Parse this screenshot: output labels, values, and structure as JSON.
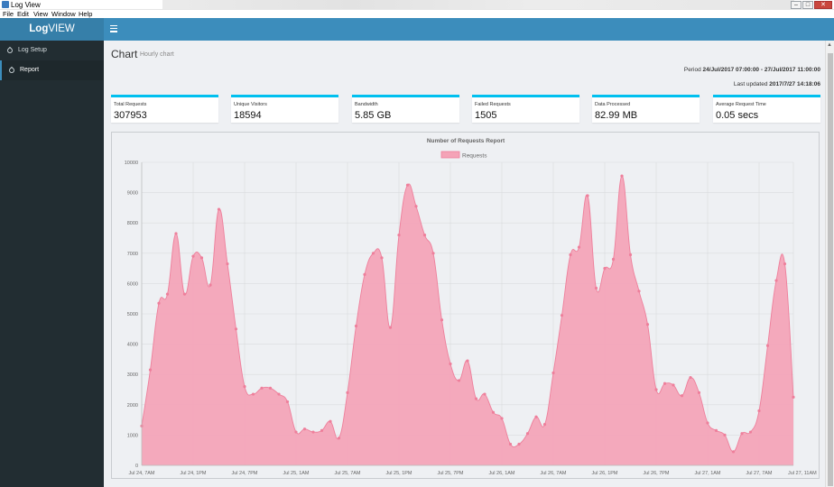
{
  "window": {
    "title": "Log View"
  },
  "menu": [
    "File",
    "Edit",
    "View",
    "Window",
    "Help"
  ],
  "sidebar": {
    "brand_bold": "Log",
    "brand_rest": "VIEW",
    "items": [
      {
        "label": "Log Setup"
      },
      {
        "label": "Report"
      }
    ]
  },
  "header": {
    "title": "Chart",
    "subtitle": "Hourly chart",
    "period_label": "Period",
    "period_value": "24/Jul/2017 07:00:00 - 27/Jul/2017 11:00:00",
    "updated_label": "Last updated",
    "updated_value": "2017/7/27 14:18:06"
  },
  "stats": [
    {
      "label": "Total Requests",
      "value": "307953"
    },
    {
      "label": "Unique Visitors",
      "value": "18594"
    },
    {
      "label": "Bandwidth",
      "value": "5.85 GB"
    },
    {
      "label": "Failed Requests",
      "value": "1505"
    },
    {
      "label": "Data Processed",
      "value": "82.99 MB"
    },
    {
      "label": "Average Request Time",
      "value": "0.05 secs"
    }
  ],
  "colors": {
    "accent": "#00c0ef",
    "nav": "#3c8dbc",
    "sidebar": "#222d32",
    "series_fill": "#f4a3b7",
    "series_line": "#ee7f9b"
  },
  "chart_data": {
    "type": "area",
    "title": "Number of Requests Report",
    "legend": "top",
    "grid": true,
    "ylim": [
      0,
      10000
    ],
    "yticks": [
      0,
      1000,
      2000,
      3000,
      4000,
      5000,
      6000,
      7000,
      8000,
      9000,
      10000
    ],
    "xtick_labels": [
      "Jul 24, 7AM",
      "Jul 24, 1PM",
      "Jul 24, 7PM",
      "Jul 25, 1AM",
      "Jul 25, 7AM",
      "Jul 25, 1PM",
      "Jul 25, 7PM",
      "Jul 26, 1AM",
      "Jul 26, 7AM",
      "Jul 26, 1PM",
      "Jul 26, 7PM",
      "Jul 27, 1AM",
      "Jul 27, 7AM",
      "Jul 27, 11AM"
    ],
    "series": [
      {
        "name": "Requests",
        "values": [
          1300,
          3150,
          5350,
          5650,
          7650,
          5650,
          6900,
          6850,
          5950,
          8450,
          6650,
          4500,
          2600,
          2350,
          2550,
          2550,
          2350,
          2100,
          1100,
          1200,
          1100,
          1150,
          1450,
          900,
          2400,
          4600,
          6300,
          7000,
          6850,
          4550,
          7600,
          9250,
          8550,
          7600,
          7000,
          4800,
          3350,
          2800,
          3450,
          2200,
          2350,
          1750,
          1550,
          700,
          700,
          1050,
          1600,
          1350,
          3050,
          4950,
          6950,
          7200,
          8900,
          5850,
          6500,
          6800,
          9550,
          6950,
          5750,
          4650,
          2500,
          2700,
          2650,
          2300,
          2900,
          2400,
          1400,
          1150,
          1000,
          450,
          1050,
          1100,
          1800,
          3950,
          6100,
          6650,
          2250
        ]
      }
    ]
  }
}
